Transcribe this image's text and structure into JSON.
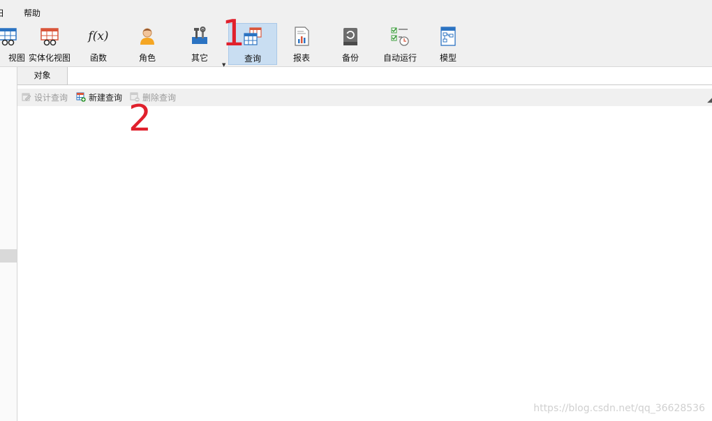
{
  "menubar": {
    "items": [
      "日",
      "帮助"
    ]
  },
  "toolbar": {
    "buttons": [
      {
        "label": "视图",
        "icon": "view-icon"
      },
      {
        "label": "实体化视图",
        "icon": "materialized-view-icon"
      },
      {
        "label": "函数",
        "icon": "function-icon"
      },
      {
        "label": "角色",
        "icon": "role-icon"
      },
      {
        "label": "其它",
        "icon": "other-tools-icon"
      },
      {
        "label": "查询",
        "icon": "query-icon"
      },
      {
        "label": "报表",
        "icon": "report-icon"
      },
      {
        "label": "备份",
        "icon": "backup-icon"
      },
      {
        "label": "自动运行",
        "icon": "auto-run-icon"
      },
      {
        "label": "模型",
        "icon": "model-icon"
      }
    ],
    "active": "查询",
    "function_glyph": "f(x)"
  },
  "tabs": {
    "objects": "对象"
  },
  "object_toolbar": {
    "design_query": "设计查询",
    "new_query": "新建查询",
    "delete_query": "删除查询"
  },
  "annotations": {
    "step1": "1",
    "step2": "2"
  },
  "watermark": "https://blog.csdn.net/qq_36628536",
  "colors": {
    "active_button_bg": "#c9def2",
    "annotation": "#e0202c",
    "toolbar_bg": "#f0f0f0"
  }
}
